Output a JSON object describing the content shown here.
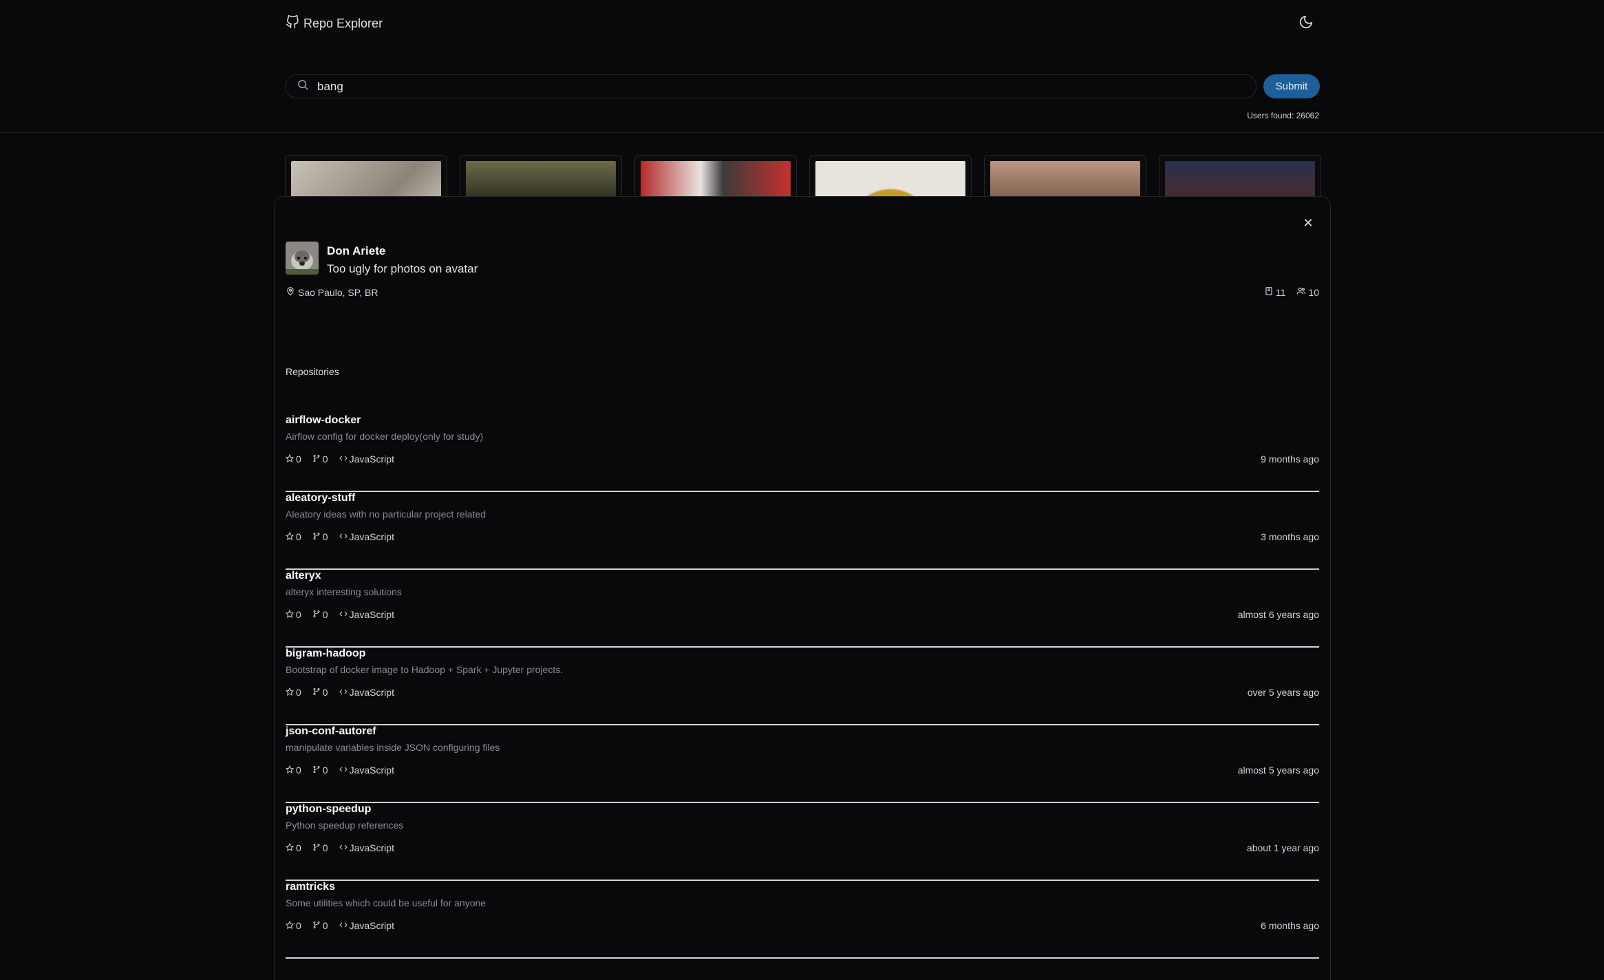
{
  "header": {
    "brand": "Repo Explorer",
    "brand_icon": "github-icon",
    "theme_icon": "moon-icon"
  },
  "search": {
    "value": "bang",
    "submit_label": "Submit",
    "users_found": "Users found: 26062"
  },
  "profile": {
    "name": "Don Ariete",
    "bio": "Too ugly for photos on avatar",
    "location": "Sao Paulo, SP, BR",
    "repos_count": "11",
    "followers_count": "10"
  },
  "repositories_title": "Repositories",
  "repos": [
    {
      "name": "airflow-docker",
      "description": "Airflow config for docker deploy(only for study)",
      "stars": "0",
      "forks": "0",
      "language": "JavaScript",
      "updated": "9 months ago"
    },
    {
      "name": "aleatory-stuff",
      "description": "Aleatory ideas with no particular project related",
      "stars": "0",
      "forks": "0",
      "language": "JavaScript",
      "updated": "3 months ago"
    },
    {
      "name": "alteryx",
      "description": "alteryx interesting solutions",
      "stars": "0",
      "forks": "0",
      "language": "JavaScript",
      "updated": "almost 6 years ago"
    },
    {
      "name": "bigram-hadoop",
      "description": "Bootstrap of docker image to Hadoop + Spark + Jupyter projects.",
      "stars": "0",
      "forks": "0",
      "language": "JavaScript",
      "updated": "over 5 years ago"
    },
    {
      "name": "json-conf-autoref",
      "description": "manipulate variables inside JSON configuring files",
      "stars": "0",
      "forks": "0",
      "language": "JavaScript",
      "updated": "almost 5 years ago"
    },
    {
      "name": "python-speedup",
      "description": "Python speedup references",
      "stars": "0",
      "forks": "0",
      "language": "JavaScript",
      "updated": "about 1 year ago"
    },
    {
      "name": "ramtricks",
      "description": "Some utilities which could be useful for anyone",
      "stars": "0",
      "forks": "0",
      "language": "JavaScript",
      "updated": "6 months ago"
    }
  ],
  "colors": {
    "accent": "#1d5f9a",
    "background": "#09090b",
    "border": "#27272a"
  }
}
